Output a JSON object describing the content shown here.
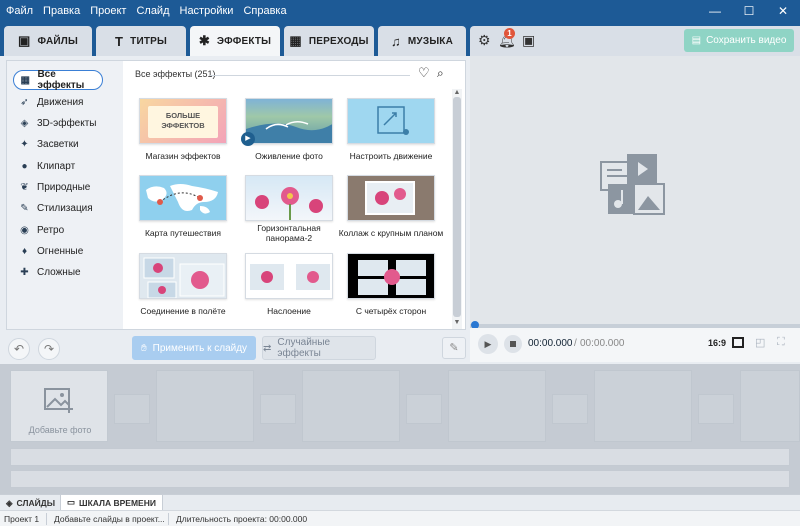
{
  "menu": [
    "Файл",
    "Правка",
    "Проект",
    "Слайд",
    "Настройки",
    "Справка"
  ],
  "window_controls": {
    "minimize": "—",
    "maximize": "☐",
    "close": "✕"
  },
  "tabs": [
    {
      "label": "ФАЙЛЫ",
      "icon": "folder-icon"
    },
    {
      "label": "ТИТРЫ",
      "icon": "text-icon"
    },
    {
      "label": "ЭФФЕКТЫ",
      "icon": "effects-star-icon",
      "active": true
    },
    {
      "label": "ПЕРЕХОДЫ",
      "icon": "transitions-icon"
    },
    {
      "label": "МУЗЫКА",
      "icon": "music-note-icon"
    }
  ],
  "toolbar": {
    "notifications_count": "1",
    "save_label": "Сохранить видео"
  },
  "categories": [
    {
      "label": "Все эффекты",
      "icon": "grid-icon",
      "active": true
    },
    {
      "label": "Движения",
      "icon": "running-icon"
    },
    {
      "label": "3D-эффекты",
      "icon": "cube-icon"
    },
    {
      "label": "Засветки",
      "icon": "sparkle-icon"
    },
    {
      "label": "Клипарт",
      "icon": "pin-icon"
    },
    {
      "label": "Природные",
      "icon": "leaf-icon"
    },
    {
      "label": "Стилизация",
      "icon": "brush-icon"
    },
    {
      "label": "Ретро",
      "icon": "camera-icon"
    },
    {
      "label": "Огненные",
      "icon": "flame-icon"
    },
    {
      "label": "Сложные",
      "icon": "puzzle-icon"
    }
  ],
  "effects_header": "Все эффекты (251)",
  "effects": [
    {
      "label": "Магазин эффектов",
      "banner": "БОЛЬШЕ\nЭФФЕКТОВ"
    },
    {
      "label": "Оживление фото"
    },
    {
      "label": "Настроить движение"
    },
    {
      "label": "Карта путешествия"
    },
    {
      "label": "Горизонтальная панорама-2"
    },
    {
      "label": "Коллаж с крупным планом"
    },
    {
      "label": "Соединение в полёте"
    },
    {
      "label": "Наслоение"
    },
    {
      "label": "С четырёх сторон"
    }
  ],
  "actions": {
    "apply_label": "Применить к слайду",
    "random_label": "Случайные эффекты"
  },
  "player": {
    "time_current": "00:00.000",
    "time_separator": "/",
    "time_total": "00:00.000",
    "ratio": "16:9"
  },
  "storyboard": {
    "add_photo_label": "Добавьте фото"
  },
  "bottom_tabs": [
    {
      "label": "СЛАЙДЫ",
      "active": false
    },
    {
      "label": "ШКАЛА ВРЕМЕНИ",
      "active": true
    }
  ],
  "status": {
    "project": "Проект 1",
    "hint": "Добавьте слайды в проект...",
    "duration": "Длительность проекта: 00:00.000"
  },
  "colors": {
    "accent": "#1d5a96",
    "save_button": "#8fd4c5",
    "apply_button": "#a9cdf0",
    "badge": "#e0553a"
  }
}
